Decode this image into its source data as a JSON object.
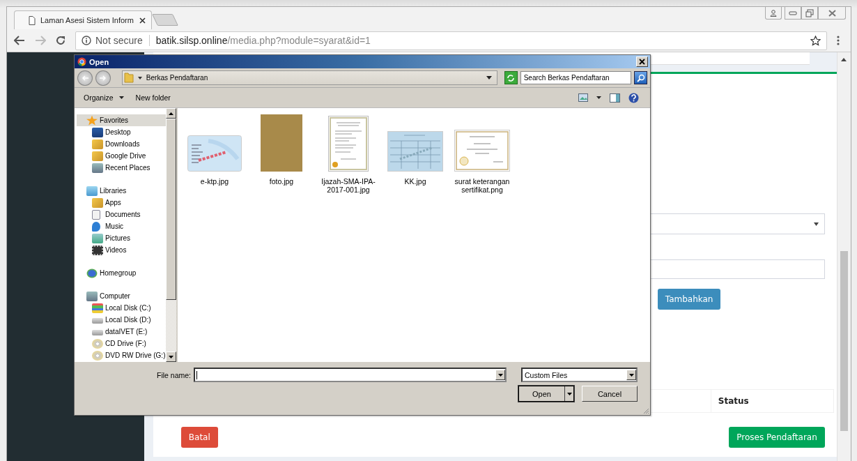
{
  "browser": {
    "tab": {
      "title": "Laman Asesi Sistem Inform"
    },
    "address": {
      "security": "Not secure",
      "host": "batik.silsp.online",
      "path": "/media.php?module=syarat&id=1"
    }
  },
  "page": {
    "buttons": {
      "add": "Tambahkan",
      "cancel": "Batal",
      "submit": "Proses Pendaftaran"
    },
    "table": {
      "columns": [
        "Status"
      ]
    }
  },
  "dialog": {
    "title": "Open",
    "location": "Berkas Pendaftaran",
    "search": {
      "placeholder": "Search Berkas Pendaftaran"
    },
    "toolbar": {
      "organize": "Organize",
      "new_folder": "New folder"
    },
    "navigation": [
      {
        "label": "Favorites",
        "selected": true,
        "children": [
          {
            "label": "Desktop",
            "selected": false
          },
          {
            "label": "Downloads",
            "selected": false
          },
          {
            "label": "Google Drive",
            "selected": false
          },
          {
            "label": "Recent Places",
            "selected": false
          }
        ]
      },
      {
        "label": "Libraries",
        "selected": false,
        "children": [
          {
            "label": "Apps",
            "selected": false
          },
          {
            "label": "Documents",
            "selected": false
          },
          {
            "label": "Music",
            "selected": false
          },
          {
            "label": "Pictures",
            "selected": false
          },
          {
            "label": "Videos",
            "selected": false
          }
        ]
      },
      {
        "label": "Homegroup",
        "selected": false
      },
      {
        "label": "Computer",
        "selected": false,
        "children": [
          {
            "label": "Local Disk (C:)",
            "selected": false
          },
          {
            "label": "Local Disk (D:)",
            "selected": false
          },
          {
            "label": "dataIVET (E:)",
            "selected": false
          },
          {
            "label": "CD Drive (F:)",
            "selected": false
          },
          {
            "label": "DVD RW Drive (G:)",
            "selected": false
          }
        ]
      }
    ],
    "files": [
      {
        "name": "e-ktp.jpg",
        "kind": "card"
      },
      {
        "name": "foto.jpg",
        "kind": "photo"
      },
      {
        "name": "Ijazah-SMA-IPA-2017-001.jpg",
        "kind": "document"
      },
      {
        "name": "KK.jpg",
        "kind": "form"
      },
      {
        "name": "surat keterangan sertifikat.png",
        "kind": "certificate"
      }
    ],
    "file_name_label": "File name:",
    "file_type": "Custom Files",
    "buttons": {
      "open": "Open",
      "cancel": "Cancel"
    }
  }
}
